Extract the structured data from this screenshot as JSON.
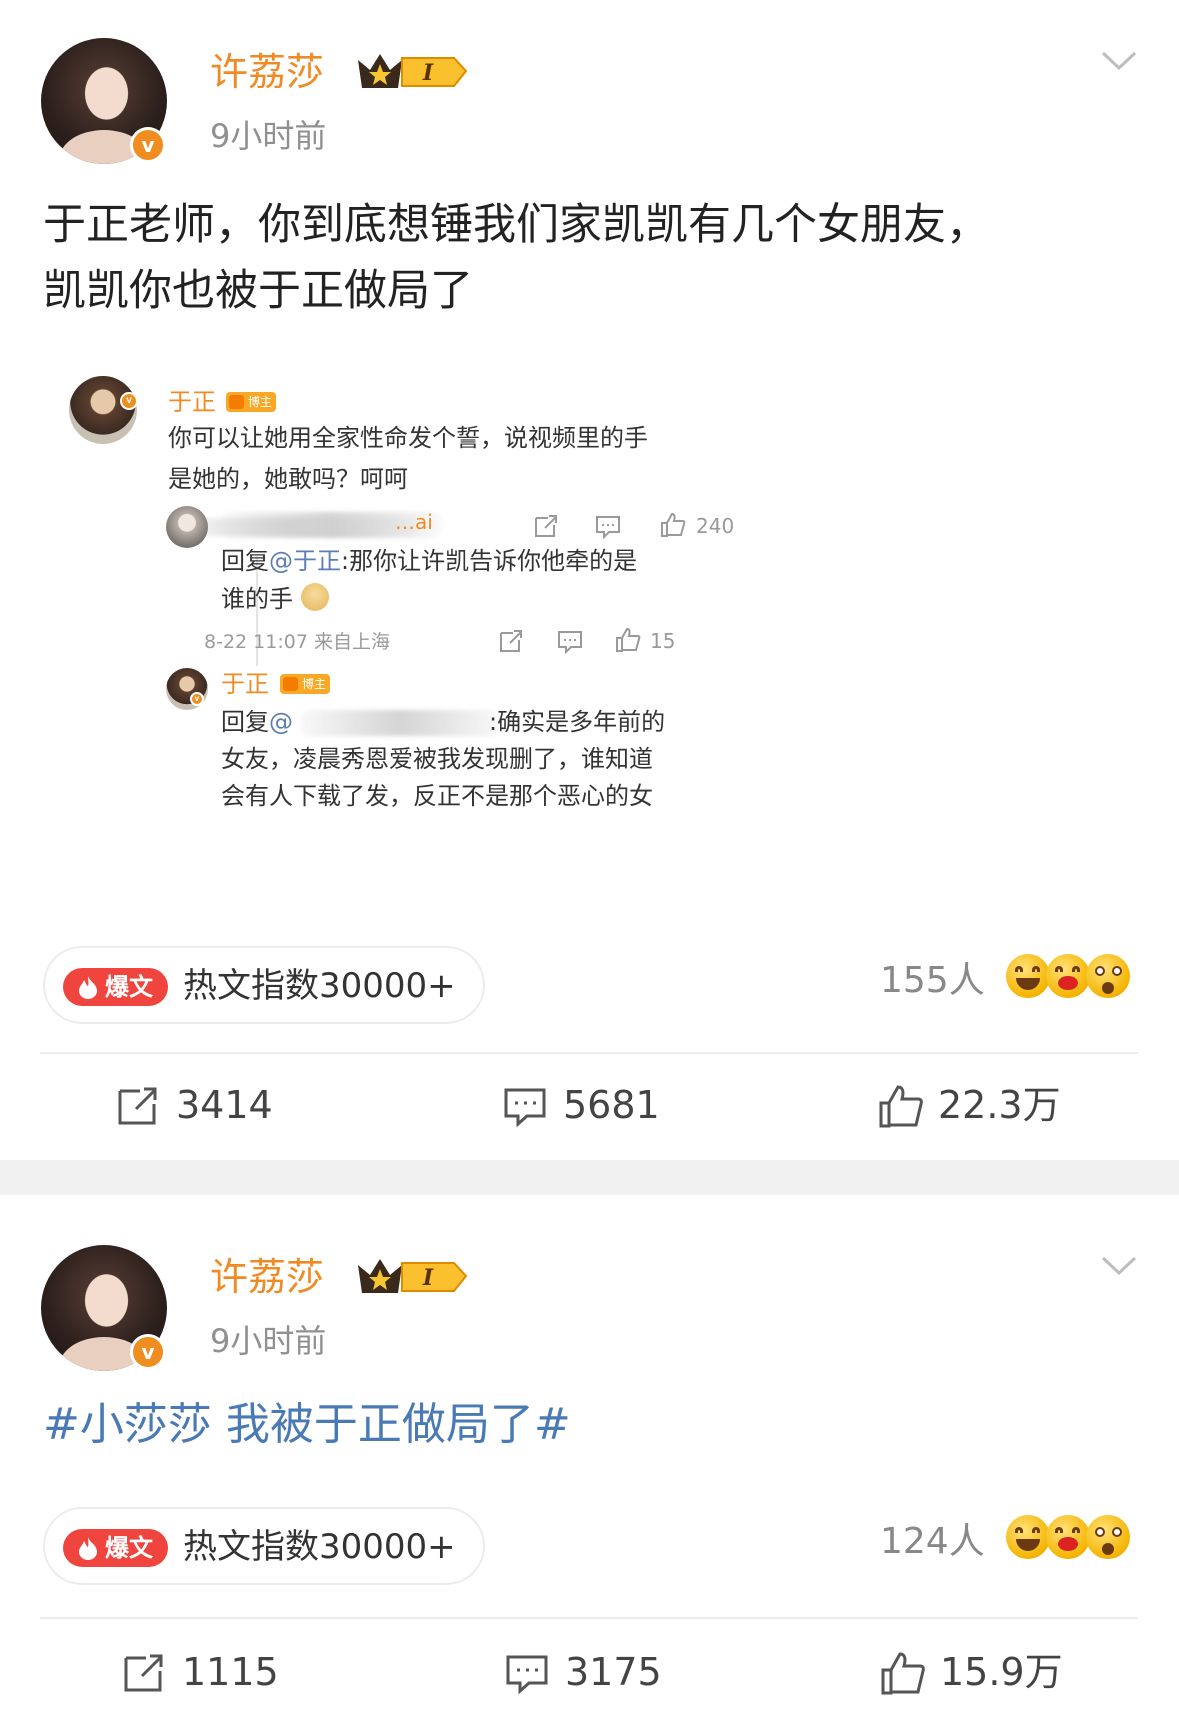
{
  "posts": [
    {
      "user": {
        "name": "许荔莎",
        "vip_badge": "I",
        "verified_mark": "v"
      },
      "time": "9小时前",
      "text_line1": "于正老师，你到底想锤我们家凯凯有几个女朋友，",
      "text_line2": "凯凯你也被于正做局了",
      "embedded_screenshot": {
        "comment": {
          "author": "于正",
          "badge": "博主",
          "line1": "你可以让她用全家性命发个誓，说视频里的手",
          "line2": "是她的，她敢吗？呵呵",
          "likes": "240"
        },
        "reply1": {
          "author_visible": "…ai",
          "prefix": "回复",
          "mention": "@于正",
          "line1_rest": ":那你让许凯告诉你他牵的是",
          "line2": "谁的手",
          "meta": "8-22 11:07 来自上海",
          "likes": "15"
        },
        "reply2": {
          "author": "于正",
          "badge": "博主",
          "prefix": "回复",
          "mention": "@",
          "line1_rest": ":确实是多年前的",
          "line2": "女友，凌晨秀恩爱被我发现删了，谁知道",
          "line3": "会有人下载了发，反正不是那个恶心的女"
        }
      },
      "hot": {
        "pill": "爆文",
        "label": "热文指数30000+"
      },
      "reactions_people": "155人",
      "actions": {
        "repost": "3414",
        "comment": "5681",
        "like": "22.3万"
      }
    },
    {
      "user": {
        "name": "许荔莎",
        "vip_badge": "I",
        "verified_mark": "v"
      },
      "time": "9小时前",
      "text": "#小莎莎 我被于正做局了#",
      "hot": {
        "pill": "爆文",
        "label": "热文指数30000+"
      },
      "reactions_people": "124人",
      "actions": {
        "repost": "1115",
        "comment": "3175",
        "like": "15.9万"
      }
    }
  ],
  "colors": {
    "username": "#f28a24",
    "hashtag": "#4a7ab6",
    "hot_pill": "#f0453e",
    "separator": "#f1f1f1"
  }
}
